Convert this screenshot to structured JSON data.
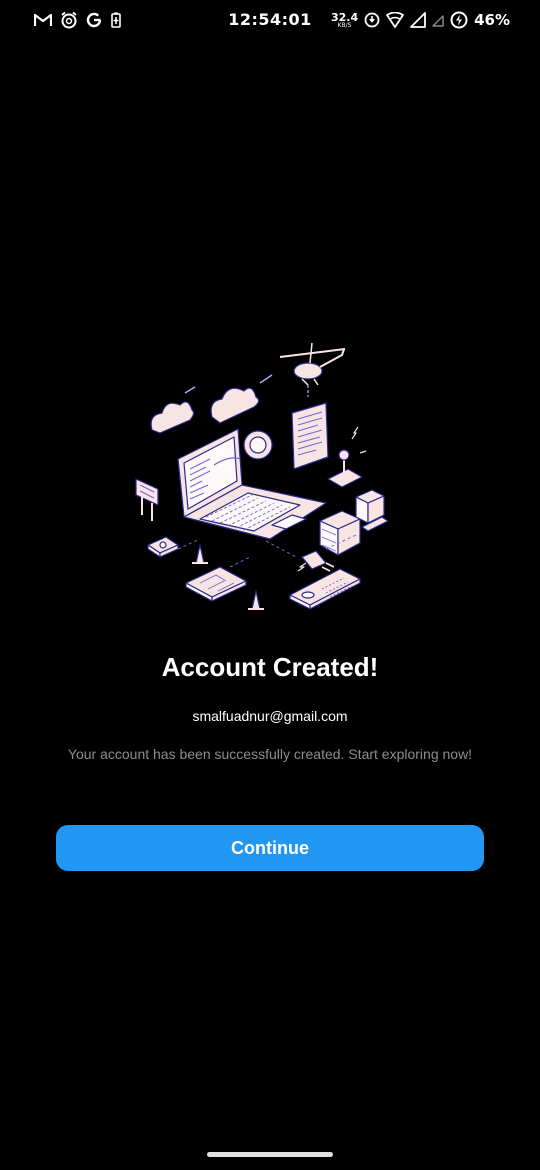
{
  "status_bar": {
    "time": "12:54:01",
    "net_speed_value": "32.4",
    "net_speed_unit": "KB/S",
    "battery_percent": "46%",
    "left_icons": [
      "gmail-icon",
      "alarm-app-icon",
      "google-icon",
      "battery-saver-icon"
    ],
    "right_icons": [
      "data-saver-icon",
      "wifi-icon",
      "signal-icon",
      "signal-2-icon",
      "battery-charging-icon"
    ]
  },
  "main": {
    "title": "Account Created!",
    "email": "smalfuadnur@gmail.com",
    "description": "Your account has been successfully created. Start exploring now!",
    "continue_label": "Continue"
  },
  "colors": {
    "background": "#000000",
    "accent": "#2196f3",
    "description_text": "#8d8d8d",
    "illustration_fill": "#f9e4e4",
    "illustration_line": "#2a2a8a"
  }
}
